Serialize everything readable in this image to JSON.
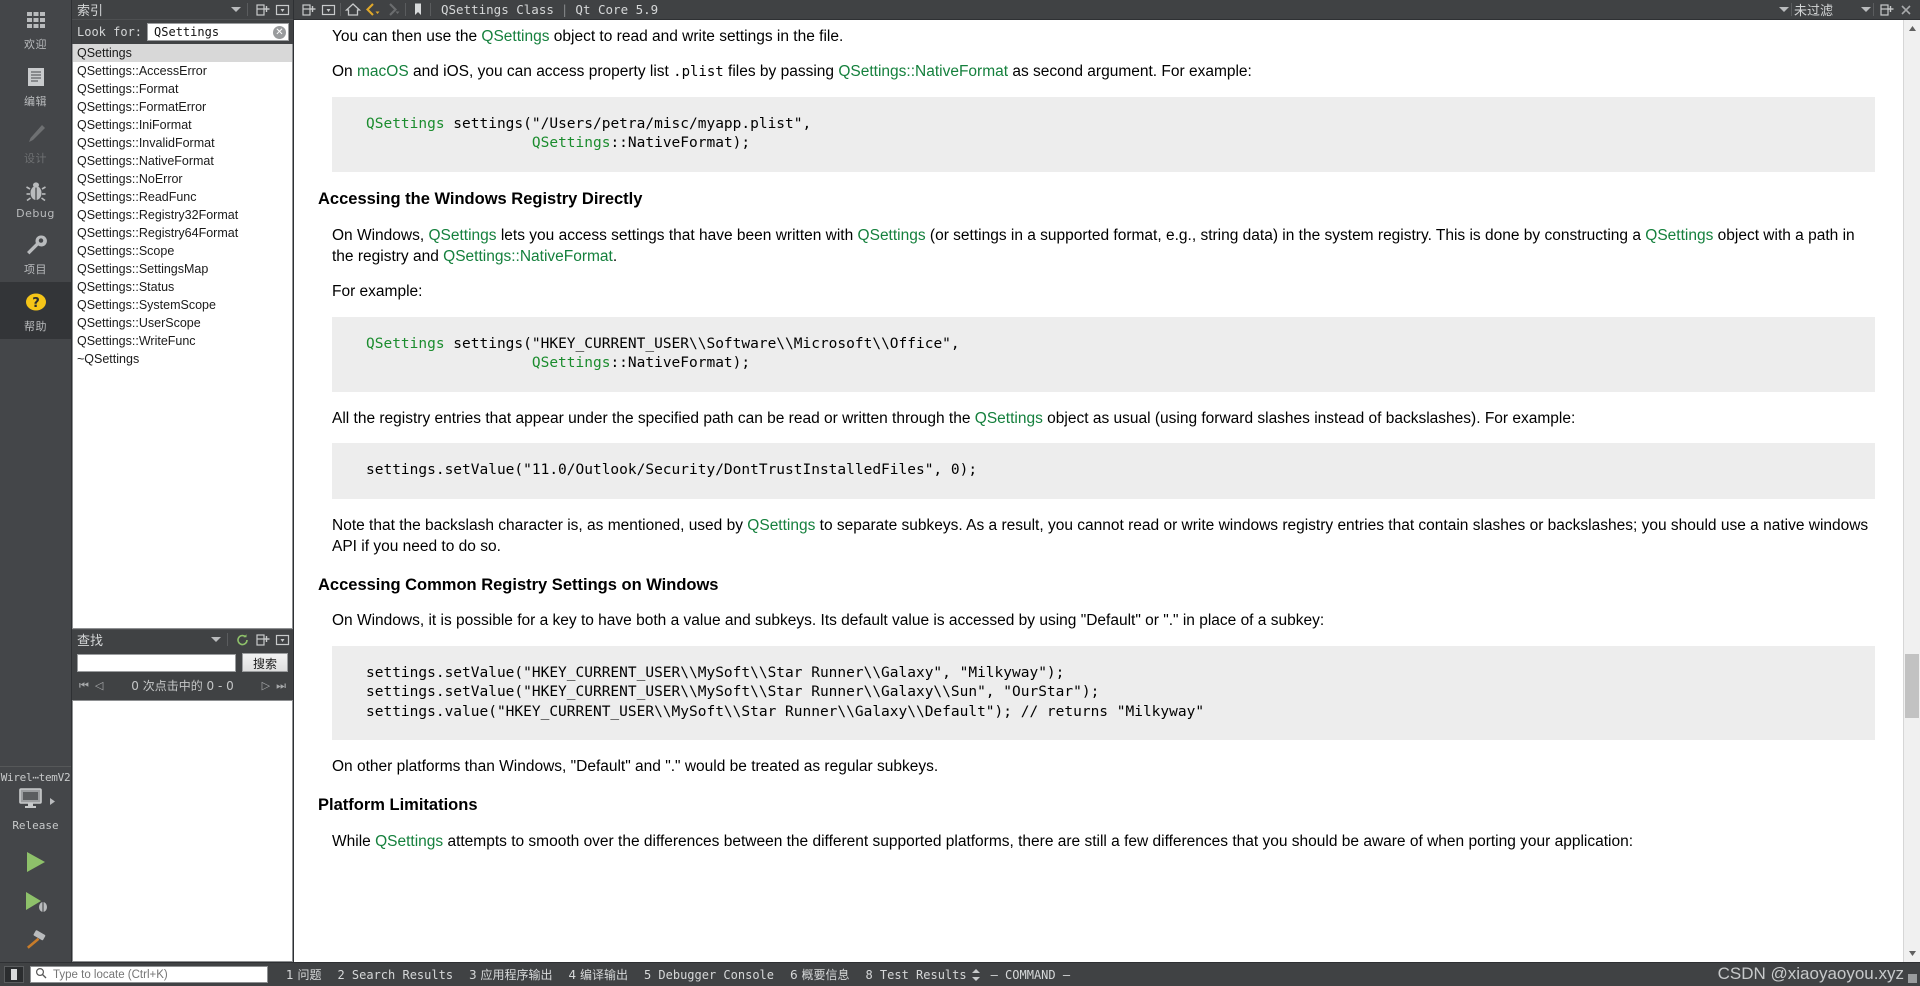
{
  "modebar": {
    "items": [
      {
        "label": "欢迎",
        "icon": "grid-icon",
        "state": "normal"
      },
      {
        "label": "编辑",
        "icon": "document-icon",
        "state": "normal"
      },
      {
        "label": "设计",
        "icon": "pencil-icon",
        "state": "disabled"
      },
      {
        "label": "Debug",
        "icon": "bug-icon",
        "state": "normal"
      },
      {
        "label": "项目",
        "icon": "wrench-icon",
        "state": "normal"
      },
      {
        "label": "帮助",
        "icon": "question-help-icon",
        "state": "active"
      }
    ],
    "kit": {
      "name": "Wirel⋯temV2",
      "build_config": "Release",
      "target_icon": "desktop-monitor-icon",
      "run_label": "run-button",
      "debug_label": "run-debug-button",
      "build_label": "build-hammer-button"
    }
  },
  "help_panel": {
    "title": "索引",
    "look_for_label": "Look for:",
    "look_for_value": "QSettings",
    "index_items": [
      "QSettings",
      "QSettings::AccessError",
      "QSettings::Format",
      "QSettings::FormatError",
      "QSettings::IniFormat",
      "QSettings::InvalidFormat",
      "QSettings::NativeFormat",
      "QSettings::NoError",
      "QSettings::ReadFunc",
      "QSettings::Registry32Format",
      "QSettings::Registry64Format",
      "QSettings::Scope",
      "QSettings::SettingsMap",
      "QSettings::Status",
      "QSettings::SystemScope",
      "QSettings::UserScope",
      "QSettings::WriteFunc",
      "~QSettings"
    ],
    "selected_index": 0,
    "search": {
      "title": "查找",
      "input_value": "",
      "button_label": "搜索",
      "hits_text": "0 次点击中的 0 - 0"
    }
  },
  "viewer": {
    "breadcrumb_title": "QSettings Class",
    "breadcrumb_sep": "|",
    "breadcrumb_module": "Qt Core 5.9",
    "filter_label": "未过滤"
  },
  "doc": {
    "p1_pre": "You can then use the ",
    "p1_link": "QSettings",
    "p1_post": " object to read and write settings in the file.",
    "p2_a": "On ",
    "p2_link1": "macOS",
    "p2_b": " and iOS, you can access property list ",
    "p2_code": ".plist",
    "p2_c": " files by passing ",
    "p2_link2": "QSettings::NativeFormat",
    "p2_d": " as second argument. For example:",
    "code1": "QSettings settings(\"/Users/petra/misc/myapp.plist\",\n                   QSettings::NativeFormat);",
    "code1_tok1": "QSettings",
    "code1_tok2": "QSettings",
    "h1": "Accessing the Windows Registry Directly",
    "p3_a": "On Windows, ",
    "p3_link1": "QSettings",
    "p3_b": " lets you access settings that have been written with ",
    "p3_link2": "QSettings",
    "p3_c": " (or settings in a supported format, e.g., string data) in the system registry. This is done by constructing a ",
    "p3_link3": "QSettings",
    "p3_d": " object with a path in the registry and ",
    "p3_link4": "QSettings::NativeFormat",
    "p3_e": ".",
    "p4": "For example:",
    "code2_l1_a": "QSettings",
    "code2_l1_b": " settings(\"HKEY_CURRENT_USER\\\\Software\\\\Microsoft\\\\Office\",",
    "code2_l2_a": "                   QSettings",
    "code2_l2_b": "::NativeFormat);",
    "p5_a": "All the registry entries that appear under the specified path can be read or written through the ",
    "p5_link": "QSettings",
    "p5_b": " object as usual (using forward slashes instead of backslashes). For example:",
    "code3": "settings.setValue(\"11.0/Outlook/Security/DontTrustInstalledFiles\", 0);",
    "p6_a": "Note that the backslash character is, as mentioned, used by ",
    "p6_link": "QSettings",
    "p6_b": " to separate subkeys. As a result, you cannot read or write windows registry entries that contain slashes or backslashes; you should use a native windows API if you need to do so.",
    "h2": "Accessing Common Registry Settings on Windows",
    "p7": "On Windows, it is possible for a key to have both a value and subkeys. Its default value is accessed by using \"Default\" or \".\" in place of a subkey:",
    "code4": "settings.setValue(\"HKEY_CURRENT_USER\\\\MySoft\\\\Star Runner\\\\Galaxy\", \"Milkyway\");\nsettings.setValue(\"HKEY_CURRENT_USER\\\\MySoft\\\\Star Runner\\\\Galaxy\\\\Sun\", \"OurStar\");\nsettings.value(\"HKEY_CURRENT_USER\\\\MySoft\\\\Star Runner\\\\Galaxy\\\\Default\"); // returns \"Milkyway\"",
    "p8": "On other platforms than Windows, \"Default\" and \".\" would be treated as regular subkeys.",
    "h3": "Platform Limitations",
    "p9_a": "While ",
    "p9_link": "QSettings",
    "p9_b": " attempts to smooth over the differences between the different supported platforms, there are still a few differences that you should be aware of when porting your application:"
  },
  "bottombar": {
    "locator_placeholder": "Type to locate (Ctrl+K)",
    "locator_value": "",
    "outputs": [
      "1 问题",
      "2 Search Results",
      "3 应用程序输出",
      "4 编译输出",
      "5 Debugger Console",
      "6 概要信息",
      "8 Test Results"
    ],
    "command_label": "— COMMAND —"
  },
  "watermark": "CSDN @xiaoyaoyou.xyz",
  "colors": {
    "chrome": "#404244",
    "link_green": "#15803d",
    "code_bg": "#ededed",
    "accent_yellow": "#f5c518"
  }
}
